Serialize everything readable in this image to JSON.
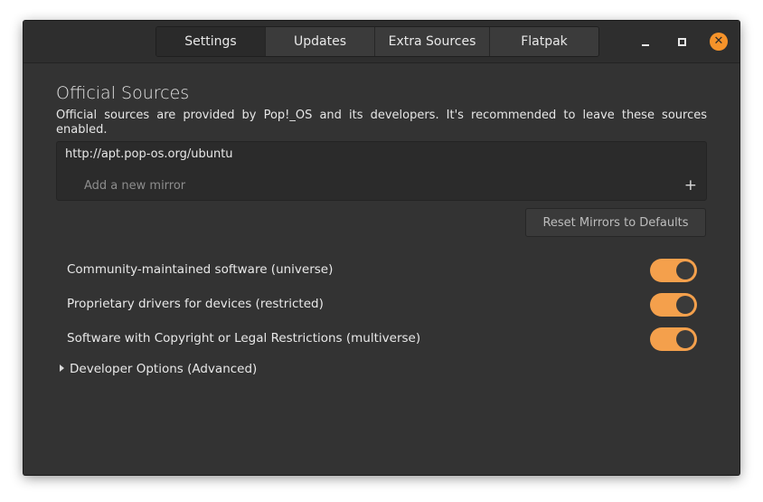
{
  "tabs": [
    {
      "label": "Settings",
      "active": true
    },
    {
      "label": "Updates"
    },
    {
      "label": "Extra Sources"
    },
    {
      "label": "Flatpak"
    }
  ],
  "window_controls": {
    "minimize": "minimize-icon",
    "maximize": "maximize-icon",
    "close": "close-icon"
  },
  "official_sources": {
    "title": "Official Sources",
    "description": "Official sources are provided by Pop!_OS and its developers. It's recommended to leave these sources enabled.",
    "mirror_url": "http://apt.pop-os.org/ubuntu",
    "add_mirror_placeholder": "Add a new mirror",
    "add_mirror_icon": "plus-icon",
    "reset_button": "Reset Mirrors to Defaults"
  },
  "components": [
    {
      "label": "Community-maintained software (universe)",
      "enabled": true
    },
    {
      "label": "Proprietary drivers for devices (restricted)",
      "enabled": true
    },
    {
      "label": "Software with Copyright or Legal Restrictions (multiverse)",
      "enabled": true
    }
  ],
  "developer_options": {
    "label": "Developer Options (Advanced)",
    "expanded": false
  },
  "colors": {
    "accent": "#f4a04c",
    "background": "#333333",
    "close_button": "#f6932a"
  }
}
